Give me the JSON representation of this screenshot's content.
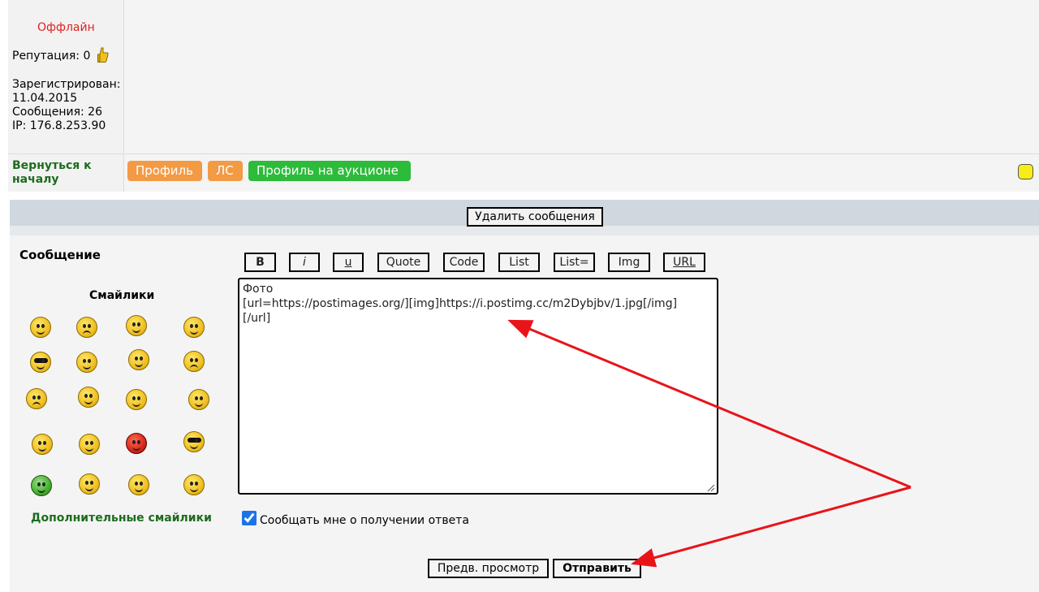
{
  "profile": {
    "status": "Оффлайн",
    "reputation_label": "Репутация: 0",
    "registered_label": "Зарегистрирован:",
    "registered_date": "11.04.2015",
    "messages_label": "Сообщения: 26",
    "ip_label": "IP: 176.8.253.90",
    "back_link": "Вернуться к началу",
    "status_color": "#e02020"
  },
  "post_actions": {
    "profile": "Профиль",
    "pm": "ЛС",
    "auction_profile": "Профиль на аукционе"
  },
  "moderation": {
    "delete_messages": "Удалить сообщения"
  },
  "reply": {
    "title": "Сообщение",
    "smilies_title": "Смайлики",
    "more_smilies": "Дополнительные смайлики",
    "toolbar": [
      "B",
      "i",
      "u",
      "Quote",
      "Code",
      "List",
      "List=",
      "Img",
      "URL"
    ],
    "message_text": "Фото\n[url=https://postimages.org/][img]https://i.postimg.cc/m2Dybjbv/1.jpg[/img]\n[/url]",
    "notify_label": "Сообщать мне о получении ответа",
    "notify_checked": true,
    "preview_button": "Предв. просмотр",
    "send_button": "Отправить"
  },
  "colors": {
    "accent_green": "#1e6b1e",
    "button_orange": "#f39a45",
    "button_green": "#2dbb3a",
    "annotation_red": "#e8141a"
  },
  "icons": [
    "thumbs-up-icon",
    "status-yellow-icon",
    "smiley-icon",
    "resize-grip-icon"
  ]
}
